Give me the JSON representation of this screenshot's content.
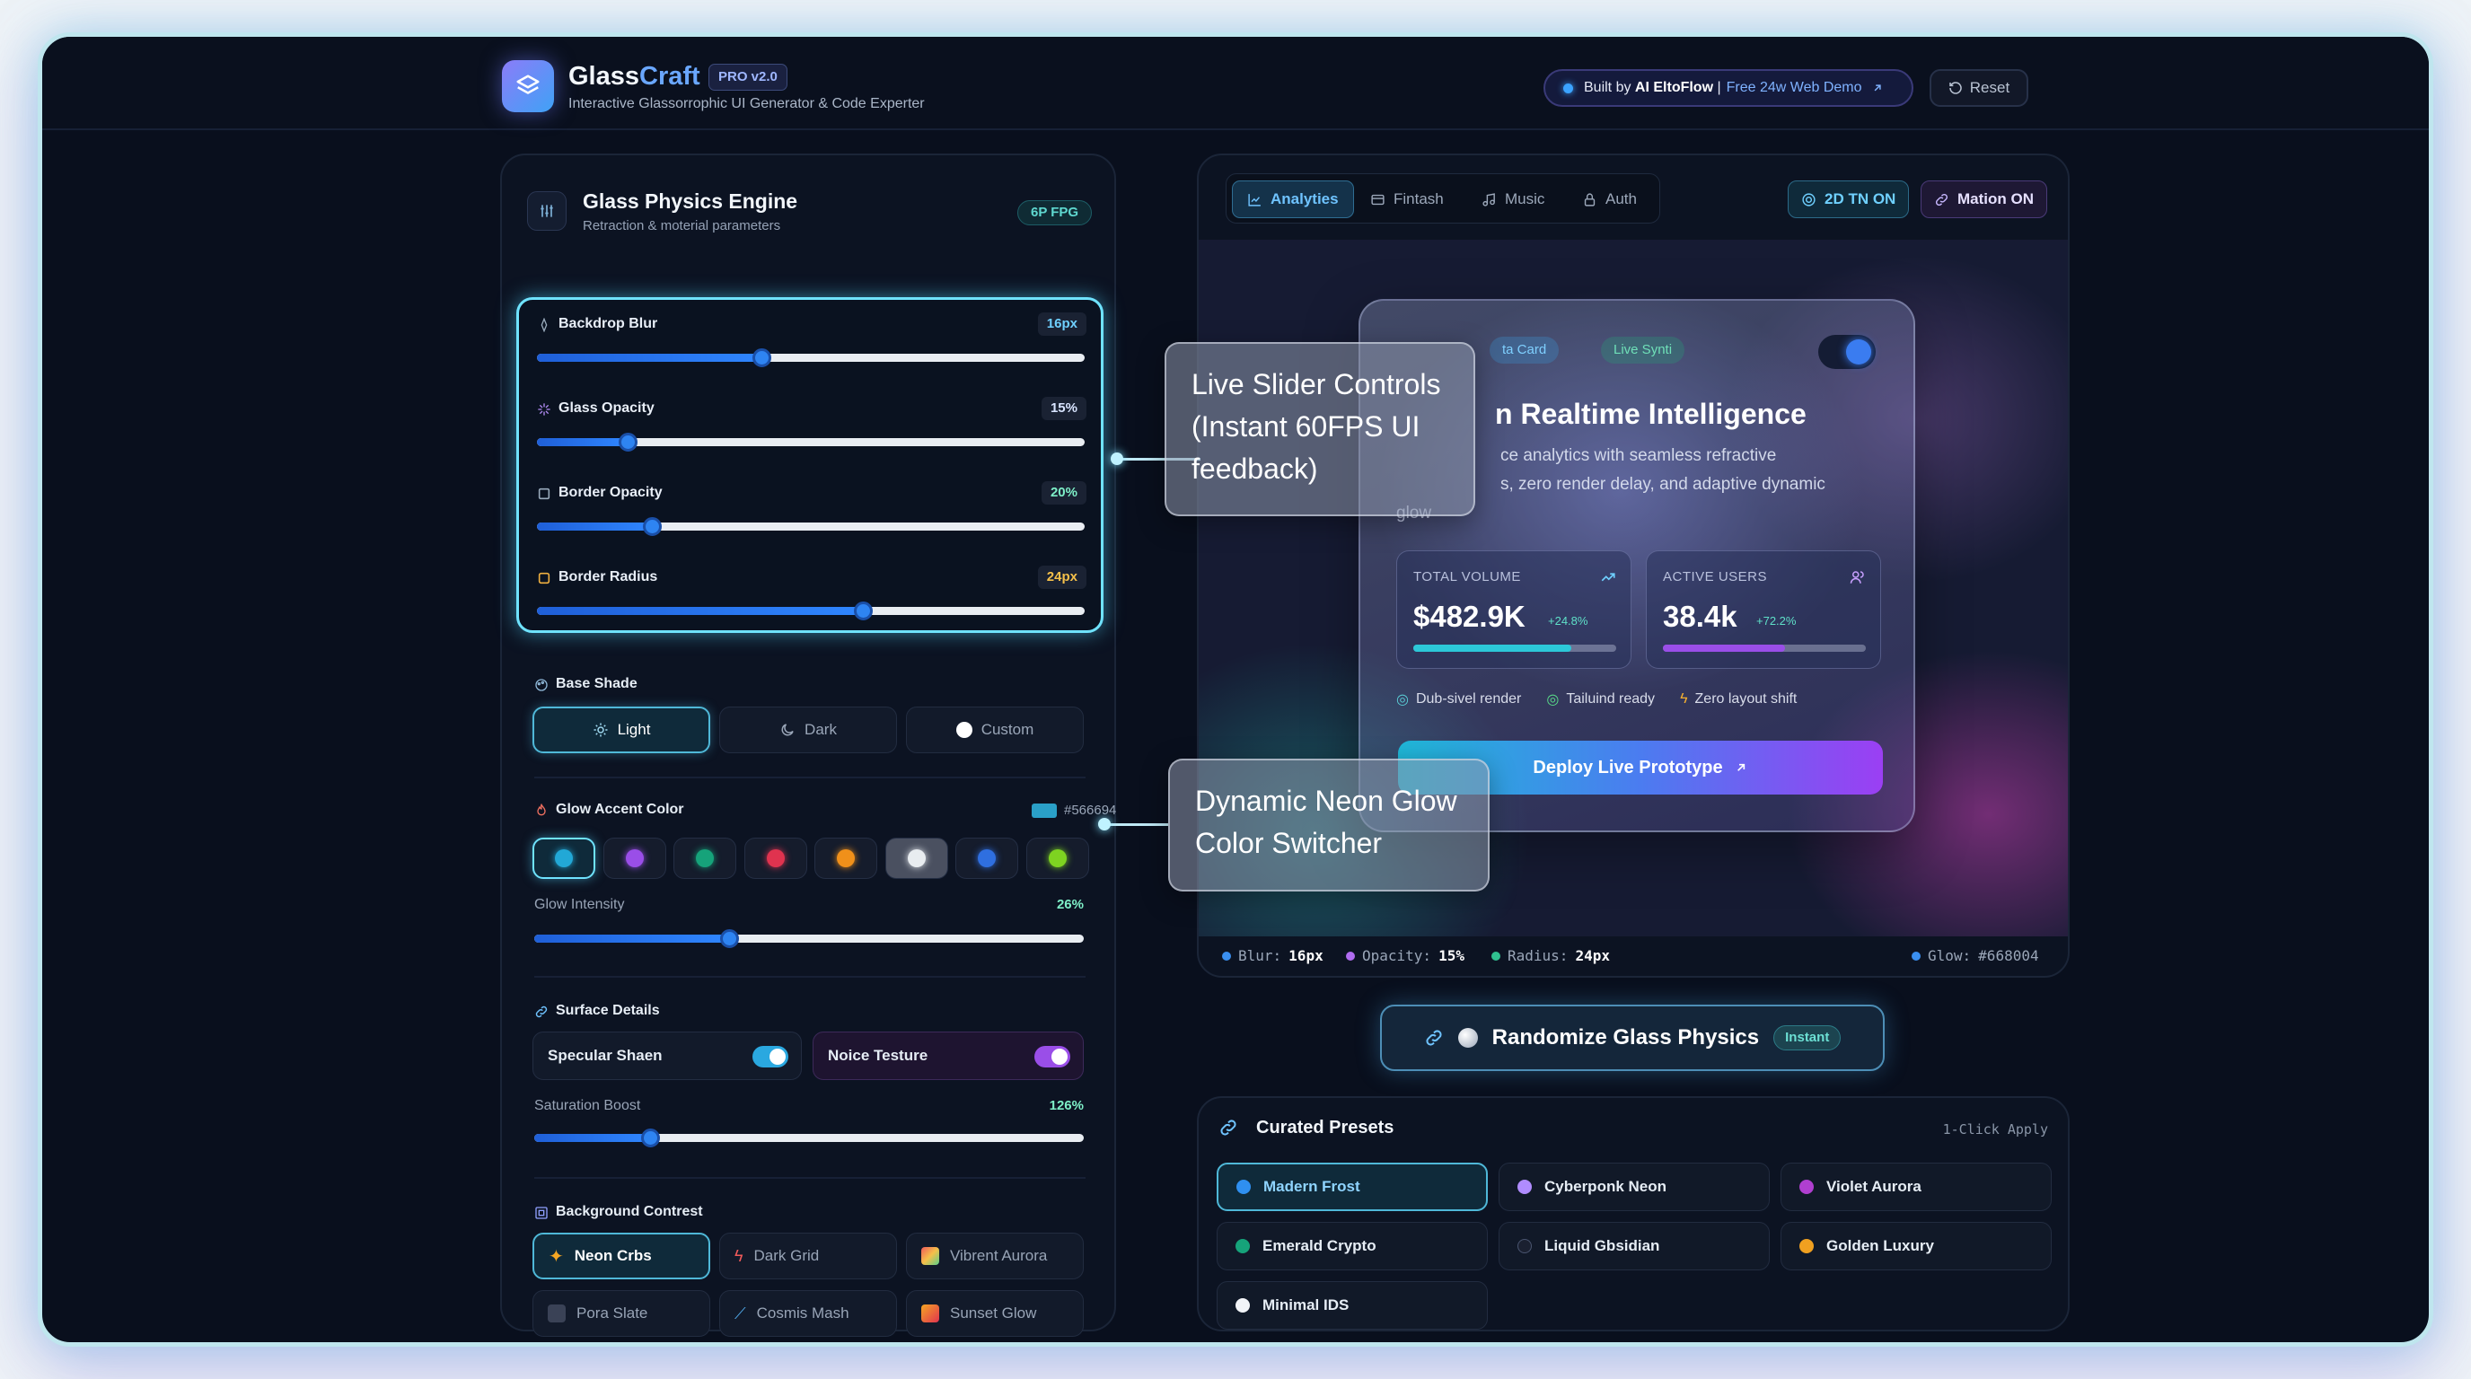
{
  "header": {
    "brand_glass": "Glass",
    "brand_craft": "Craft",
    "pro_badge": "PRO v2.0",
    "subtitle": "Interactive Glassorrophic UI Generator & Code Experter",
    "built_prefix": "Built by",
    "built_author": "AI EltoFlow",
    "built_sep": "|",
    "built_link": "Free 24w Web Demo",
    "reset_label": "Reset"
  },
  "physics": {
    "title": "Glass Physics Engine",
    "subtitle": "Retraction & moterial parameters",
    "fps_badge": "6P FPG",
    "sliders": [
      {
        "label": "Backdrop Blur",
        "value": "16px",
        "fraction": 0.41
      },
      {
        "label": "Glass Opacity",
        "value": "15%",
        "fraction": 0.165
      },
      {
        "label": "Border Opacity",
        "value": "20%",
        "fraction": 0.21
      },
      {
        "label": "Border Radius",
        "value": "24px",
        "fraction": 0.595
      }
    ]
  },
  "base_shade": {
    "title": "Base Shade",
    "options": [
      "Light",
      "Dark",
      "Custom"
    ],
    "selected": "Light"
  },
  "glow": {
    "title": "Glow Accent Color",
    "hex_label": "#566694",
    "colors": [
      "#22a8d6",
      "#9a4ee8",
      "#16a37a",
      "#e0334f",
      "#f0901a",
      "#e8ecf0",
      "#2f6fe0",
      "#7ed321"
    ],
    "selected_index": 0,
    "intensity_label": "Glow Intensity",
    "intensity_value": "26%",
    "intensity_fraction": 0.355
  },
  "surface": {
    "title": "Surface Details",
    "specular_label": "Specular Shaen",
    "noise_label": "Noice Testure",
    "saturation_label": "Saturation Boost",
    "saturation_value": "126%",
    "saturation_fraction": 0.21
  },
  "background": {
    "title": "Background Contrest",
    "tiles": [
      "Neon Crbs",
      "Dark Grid",
      "Vibrent Aurora",
      "Pora Slate",
      "Cosmis Mash",
      "Sunset Glow"
    ],
    "selected": "Neon Crbs"
  },
  "preview": {
    "tabs": [
      "Analyties",
      "Fintash",
      "Music",
      "Auth"
    ],
    "active_tab": "Analyties",
    "chip_2d": "2D TN ON",
    "chip_motion": "Mation ON",
    "card": {
      "badge1": "ta Card",
      "badge2": "Live Synti",
      "heading": "n Realtime Intelligence",
      "desc_line1": "ce analytics with seamless refractive",
      "desc_line2": "s, zero render delay, and adaptive dynamic",
      "desc_line3": "glow",
      "stat1_label": "TOTAL VOLUME",
      "stat1_value": "$482.9K",
      "stat1_delta": "+24.8%",
      "stat1_progress": 0.78,
      "stat2_label": "ACTIVE USERS",
      "stat2_value": "38.4k",
      "stat2_delta": "+72.2%",
      "stat2_progress": 0.6,
      "feature1": "Dub-sivel render",
      "feature2": "Tailuind ready",
      "feature3": "Zero layout shift",
      "deploy_label": "Deploy Live Prototype"
    },
    "callout_sliders": "Live Slider Controls (Instant 60FPS UI feedback)",
    "callout_glow": "Dynamic Neon Glow Color Switcher",
    "status": {
      "blur_key": "Blur:",
      "blur_val": "16px",
      "opacity_key": "Opacity:",
      "opacity_val": "15%",
      "radius_key": "Radius:",
      "radius_val": "24px",
      "glow_key": "Glow:",
      "glow_val": "#668004"
    }
  },
  "randomize": {
    "label": "Randomize Glass Physics",
    "badge": "Instant"
  },
  "presets": {
    "title": "Curated Presets",
    "hint": "1-Click Apply",
    "items": [
      {
        "label": "Madern Frost",
        "color": "#2f8ff0"
      },
      {
        "label": "Cyberponk Neon",
        "color": "#b08cff"
      },
      {
        "label": "Violet Aurora",
        "color": "#b03fd0"
      },
      {
        "label": "Emerald Crypto",
        "color": "#16a37a"
      },
      {
        "label": "Liquid Gbsidian",
        "color": "#1a2030"
      },
      {
        "label": "Golden Luxury",
        "color": "#f0a020"
      },
      {
        "label": "Minimal IDS",
        "color": "#f2f4f8"
      }
    ],
    "selected": "Madern Frost"
  }
}
